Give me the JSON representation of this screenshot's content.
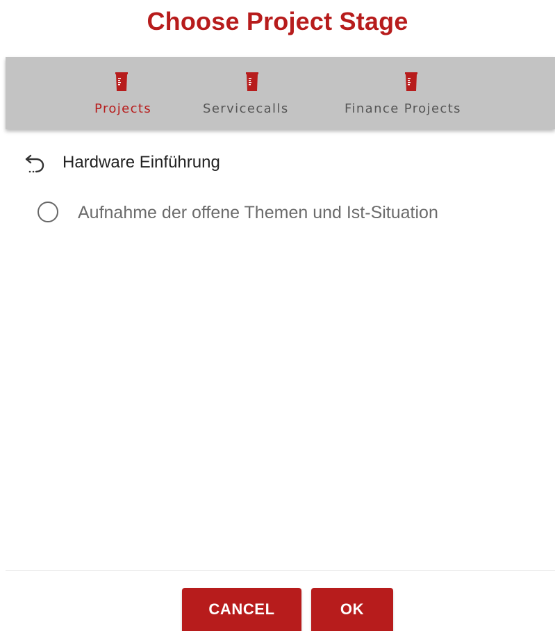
{
  "dialog": {
    "title": "Choose Project Stage"
  },
  "tabs": [
    {
      "label": "Projects",
      "icon": "project-book-icon",
      "active": true
    },
    {
      "label": "Servicecalls",
      "icon": "project-book-icon",
      "active": false
    },
    {
      "label": "Finance Projects",
      "icon": "project-book-icon",
      "active": false
    }
  ],
  "navigation": {
    "back_icon": "undo-arrow-icon",
    "current_project": "Hardware Einführung"
  },
  "stages": [
    {
      "label": "Aufnahme der offene Themen und Ist-Situation",
      "selected": false
    }
  ],
  "actions": {
    "cancel_label": "CANCEL",
    "ok_label": "OK"
  },
  "colors": {
    "accent": "#b71c1c",
    "tabbar_bg": "#c3c3c3",
    "inactive_tab_text": "#555555"
  }
}
